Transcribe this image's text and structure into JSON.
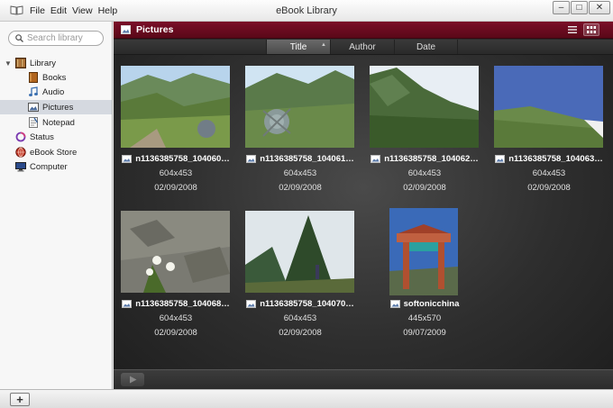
{
  "window": {
    "title": "eBook Library",
    "menu": [
      "File",
      "Edit",
      "View",
      "Help"
    ],
    "controls": {
      "minimize": "–",
      "maximize": "□",
      "close": "✕"
    }
  },
  "sidebar": {
    "search_placeholder": "Search library",
    "items": [
      {
        "label": "Library",
        "icon": "library-icon"
      },
      {
        "label": "Books",
        "icon": "book-icon"
      },
      {
        "label": "Audio",
        "icon": "music-note-icon"
      },
      {
        "label": "Pictures",
        "icon": "picture-icon",
        "selected": true
      },
      {
        "label": "Notepad",
        "icon": "notepad-icon"
      },
      {
        "label": "Status",
        "icon": "status-icon"
      },
      {
        "label": "eBook Store",
        "icon": "store-icon"
      },
      {
        "label": "Computer",
        "icon": "computer-icon"
      }
    ]
  },
  "content": {
    "header_title": "Pictures",
    "sort_tabs": [
      "Title",
      "Author",
      "Date"
    ],
    "active_sort": "Title",
    "pictures": [
      {
        "name": "n1136385758_104060…",
        "dimensions": "604x453",
        "date": "02/09/2008"
      },
      {
        "name": "n1136385758_104061…",
        "dimensions": "604x453",
        "date": "02/09/2008"
      },
      {
        "name": "n1136385758_104062…",
        "dimensions": "604x453",
        "date": "02/09/2008"
      },
      {
        "name": "n1136385758_104063…",
        "dimensions": "604x453",
        "date": "02/09/2008"
      },
      {
        "name": "n1136385758_104068…",
        "dimensions": "604x453",
        "date": "02/09/2008"
      },
      {
        "name": "n1136385758_104070…",
        "dimensions": "604x453",
        "date": "02/09/2008"
      },
      {
        "name": "softonicchina",
        "dimensions": "445x570",
        "date": "09/07/2009"
      }
    ]
  },
  "bottom": {
    "add_label": "+"
  },
  "colors": {
    "header_accent": "#6e0c22",
    "content_bg": "#2e2e2e",
    "selected_item": "#d5d9e0"
  }
}
